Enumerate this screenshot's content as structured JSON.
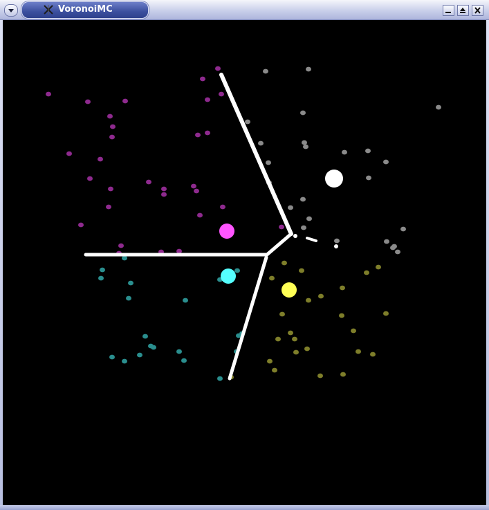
{
  "window": {
    "title": "VoronoiMC",
    "buttons": [
      "minimize",
      "maximize",
      "close"
    ]
  },
  "colors": {
    "background": "#000000",
    "boundary": "#ffffff",
    "magenta_seed": "#ff55ff",
    "magenta_points": "#8e2a8e",
    "cyan_seed": "#55ffff",
    "cyan_points": "#2a8e8e",
    "yellow_seed": "#ffff55",
    "yellow_points": "#7e7e2a",
    "white_seed": "#ffffff",
    "gray_points": "#8a8a8a"
  },
  "icons": {
    "app": "voronoi-app-icon",
    "menu": "chevron-down-icon",
    "minimize": "minimize-icon",
    "maximize": "maximize-icon",
    "close": "close-icon"
  }
}
